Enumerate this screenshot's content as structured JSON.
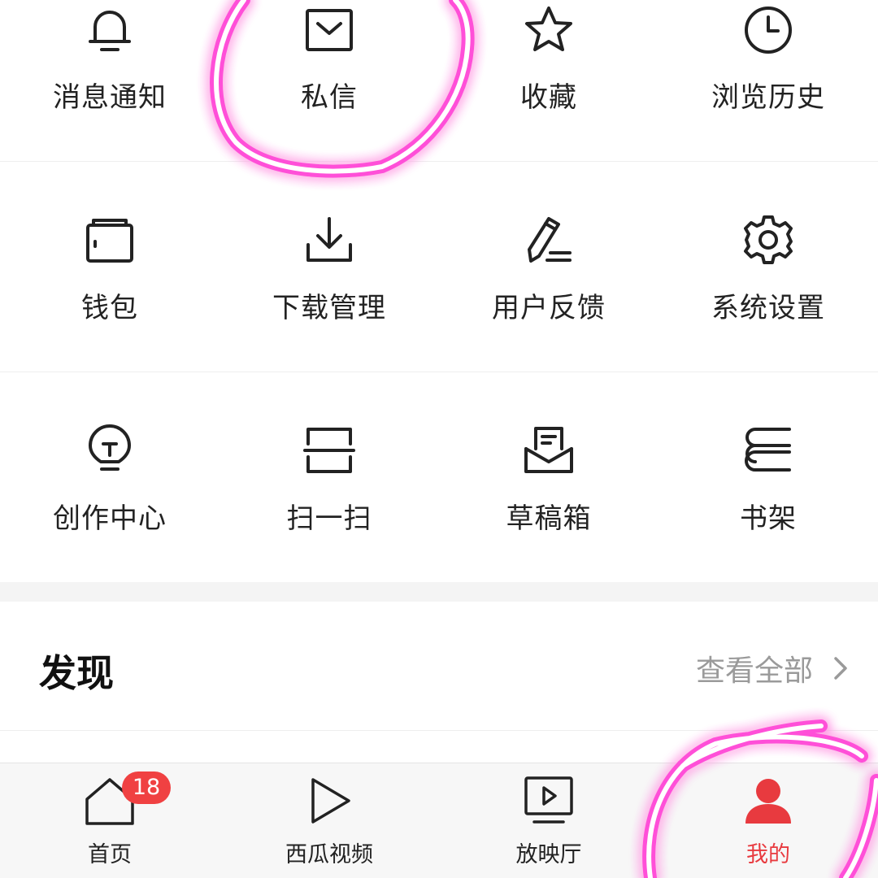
{
  "menu_rows": [
    [
      {
        "label": "消息通知",
        "icon": "bell-icon"
      },
      {
        "label": "私信",
        "icon": "envelope-icon"
      },
      {
        "label": "收藏",
        "icon": "star-icon"
      },
      {
        "label": "浏览历史",
        "icon": "clock-icon"
      }
    ],
    [
      {
        "label": "钱包",
        "icon": "wallet-icon"
      },
      {
        "label": "下载管理",
        "icon": "download-icon"
      },
      {
        "label": "用户反馈",
        "icon": "pencil-icon"
      },
      {
        "label": "系统设置",
        "icon": "gear-icon"
      }
    ],
    [
      {
        "label": "创作中心",
        "icon": "lightbulb-icon"
      },
      {
        "label": "扫一扫",
        "icon": "scan-icon"
      },
      {
        "label": "草稿箱",
        "icon": "drafts-icon"
      },
      {
        "label": "书架",
        "icon": "bookshelf-icon"
      }
    ]
  ],
  "discover": {
    "title": "发现",
    "view_all": "查看全部",
    "chevron_icon": "chevron-right-icon"
  },
  "tabbar": {
    "tabs": [
      {
        "label": "首页",
        "icon": "home-icon",
        "badge": "18"
      },
      {
        "label": "西瓜视频",
        "icon": "play-icon"
      },
      {
        "label": "放映厅",
        "icon": "tv-icon"
      },
      {
        "label": "我的",
        "icon": "user-icon",
        "active": true
      }
    ]
  },
  "colors": {
    "accent": "#e83a3f",
    "badge": "#f04142",
    "annotation": "#ff4fd8",
    "muted_text": "#9a9a9a"
  }
}
